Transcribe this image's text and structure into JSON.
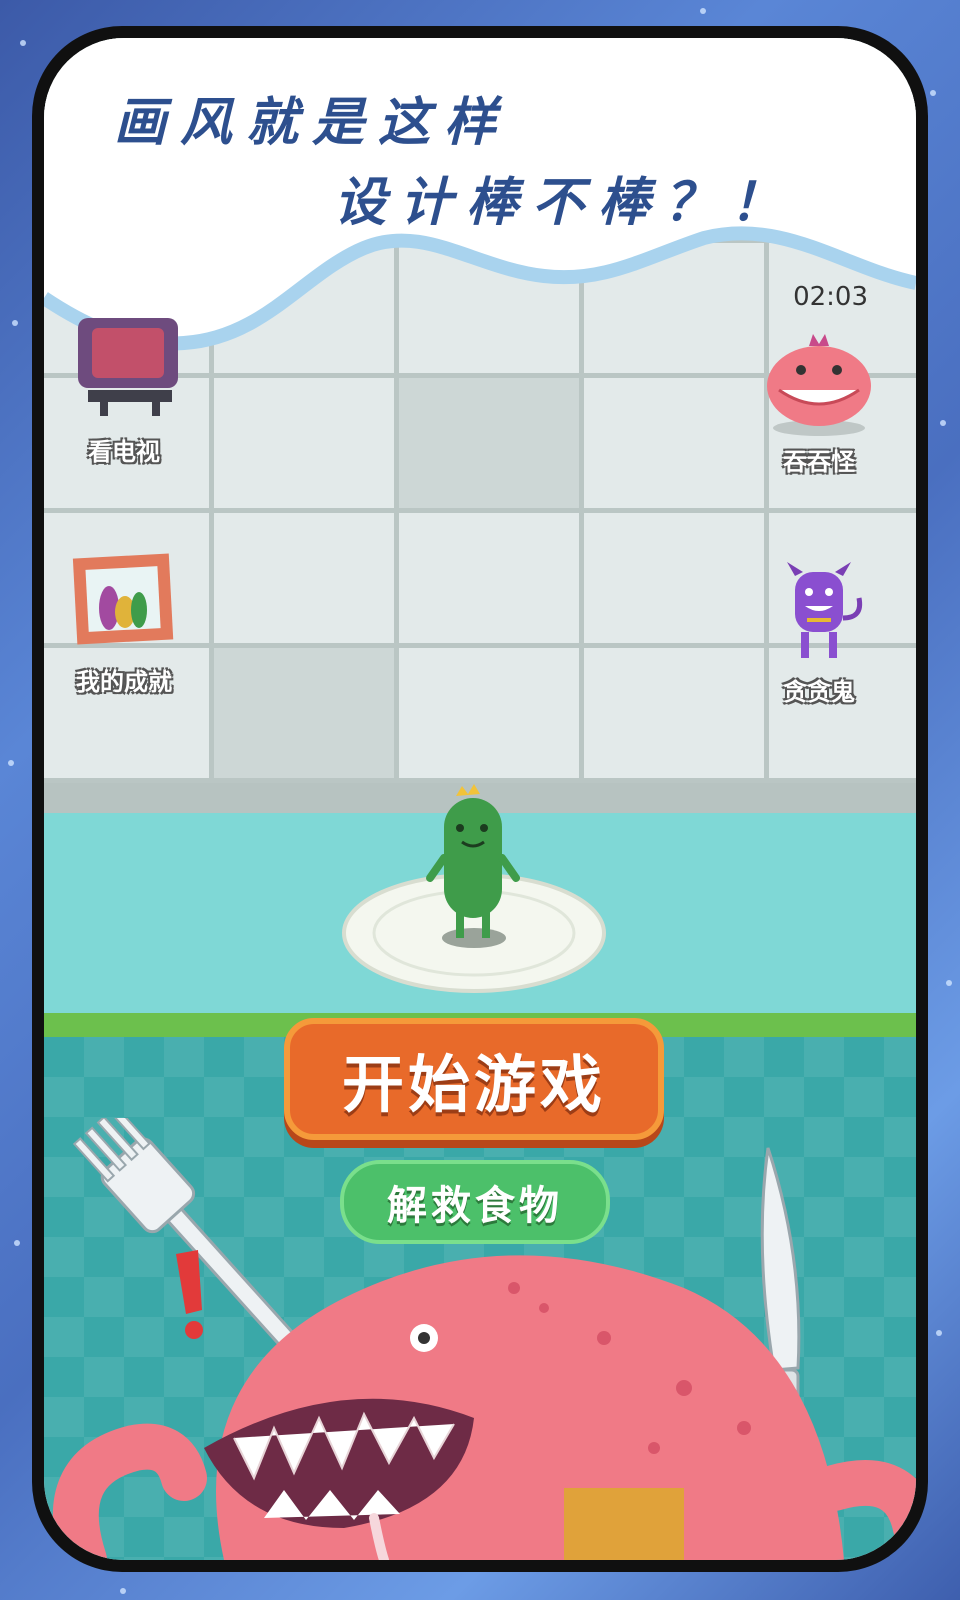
{
  "banner": {
    "line1": "画风就是这样",
    "line2": "设计棒不棒？！"
  },
  "hud": {
    "timer": "02:03"
  },
  "menu": {
    "left": [
      {
        "label": "看电视",
        "icon": "tv-icon"
      },
      {
        "label": "我的成就",
        "icon": "picture-frame-icon"
      }
    ],
    "right": [
      {
        "label": "吞吞怪",
        "icon": "pink-monster-icon"
      },
      {
        "label": "贪贪鬼",
        "icon": "purple-devil-icon"
      }
    ]
  },
  "buttons": {
    "start": "开始游戏",
    "rescue": "解救食物"
  },
  "colors": {
    "start_button": "#e86a2a",
    "rescue_button": "#4cc06a",
    "monster": "#f07a86",
    "cucumber": "#3f9c4a"
  }
}
